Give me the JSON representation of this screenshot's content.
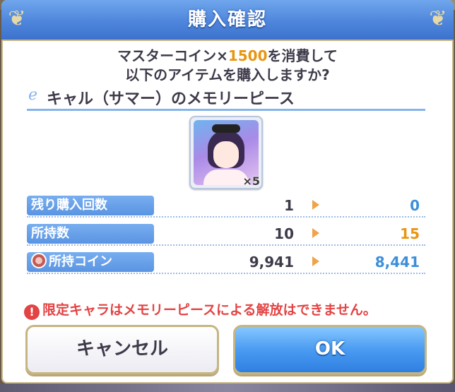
{
  "dialog": {
    "title": "購入確認",
    "message_line1_prefix": "マスターコイン×",
    "message_cost": "1500",
    "message_line1_suffix": "を消費して",
    "message_line2": "以下のアイテムを購入しますか?",
    "item_name": "キャル（サマー）のメモリーピース",
    "item_quantity": "×5",
    "rows": [
      {
        "label": "残り購入回数",
        "before": "1",
        "after": "0",
        "after_color": "blue"
      },
      {
        "label": "所持数",
        "before": "10",
        "after": "15",
        "after_color": "orange"
      },
      {
        "label": "所持コイン",
        "before": "9,941",
        "after": "8,441",
        "after_color": "blue",
        "icon": "coin-icon"
      }
    ],
    "warning": "限定キャラはメモリーピースによる解放はできません。",
    "cancel_label": "キャンセル",
    "ok_label": "OK"
  },
  "colors": {
    "title_bar": "#4f86dc",
    "accent_blue": "#3c8fda",
    "accent_orange": "#e89511",
    "warning_red": "#e34343",
    "border_gold": "#c6b582"
  }
}
